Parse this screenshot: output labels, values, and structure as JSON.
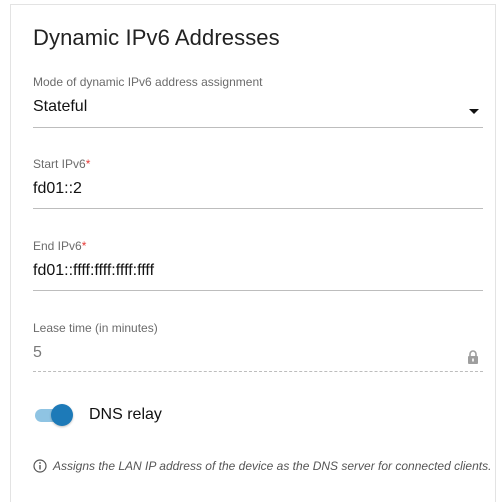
{
  "section": {
    "title": "Dynamic IPv6 Addresses"
  },
  "mode": {
    "label": "Mode of dynamic IPv6 address assignment",
    "value": "Stateful"
  },
  "start_ipv6": {
    "label": "Start IPv6",
    "required_mark": "*",
    "value": "fd01::2"
  },
  "end_ipv6": {
    "label": "End IPv6",
    "required_mark": "*",
    "value": "fd01::ffff:ffff:ffff:ffff"
  },
  "lease_time": {
    "label": "Lease time (in minutes)",
    "value": "5",
    "icon": "lock-icon"
  },
  "dns_relay": {
    "label": "DNS relay",
    "enabled": true
  },
  "hint": {
    "icon": "info-icon",
    "text": "Assigns the LAN IP address of the device as the DNS server for connected clients."
  },
  "colors": {
    "toggle_knob": "#1d7ab8",
    "toggle_track": "#8fc4e3",
    "required": "#e53935"
  }
}
